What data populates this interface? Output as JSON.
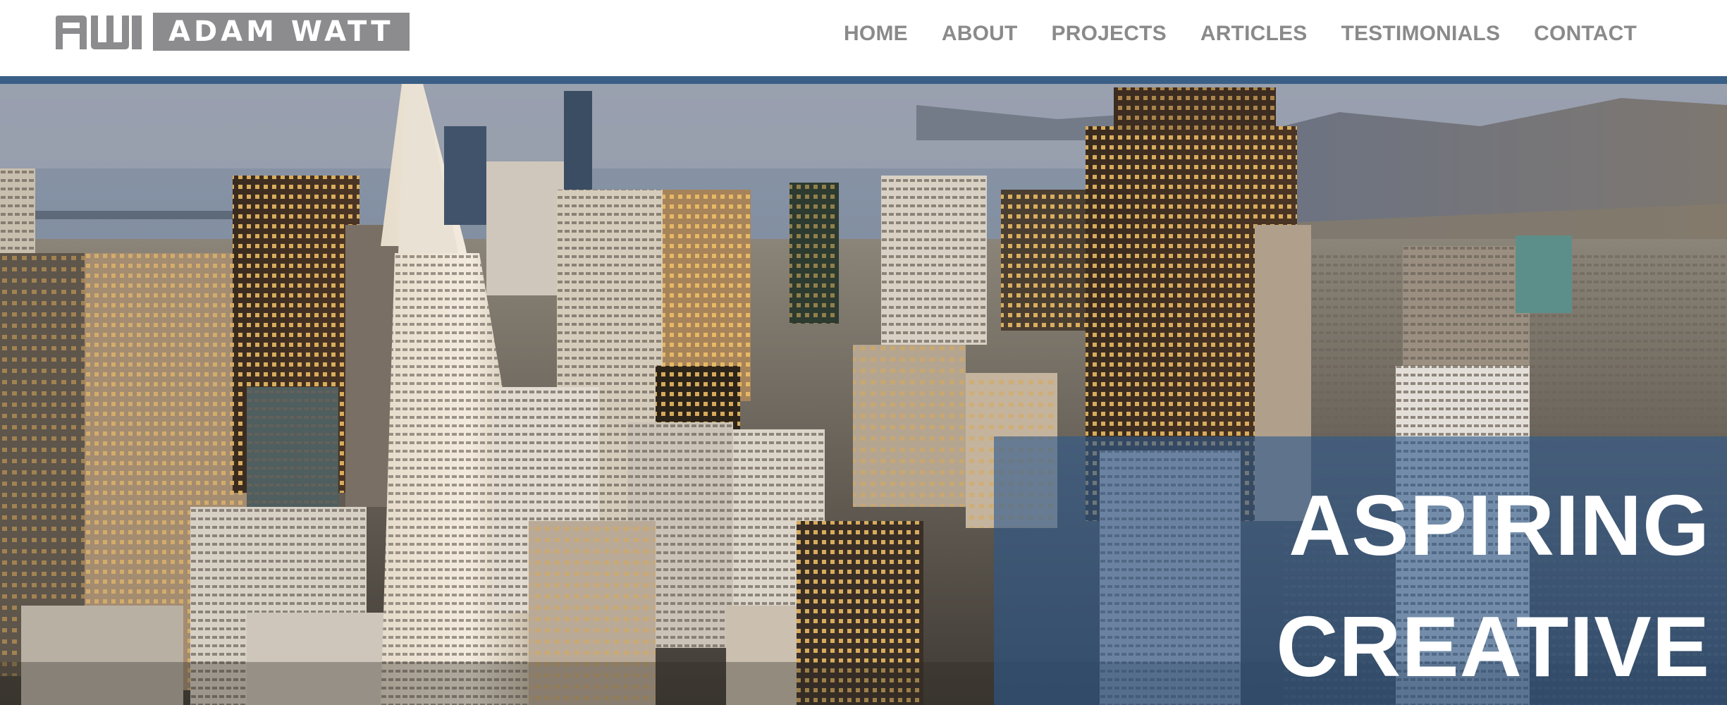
{
  "brand": {
    "monogram_icon": "aw-monogram-icon",
    "name": "ADAM WATT",
    "logo_color": "#8c8c8e"
  },
  "nav": {
    "items": [
      {
        "label": "HOME"
      },
      {
        "label": "ABOUT"
      },
      {
        "label": "PROJECTS"
      },
      {
        "label": "ARTICLES"
      },
      {
        "label": "TESTIMONIALS"
      },
      {
        "label": "CONTACT"
      }
    ],
    "text_color": "#8a8a8a"
  },
  "theme": {
    "accent": "#3a5f86",
    "overlay": "#2d588c"
  },
  "hero": {
    "image": "aerial-city-skyline-photo",
    "tagline_line1": "ASPIRING",
    "tagline_line2": "CREATIVE"
  }
}
